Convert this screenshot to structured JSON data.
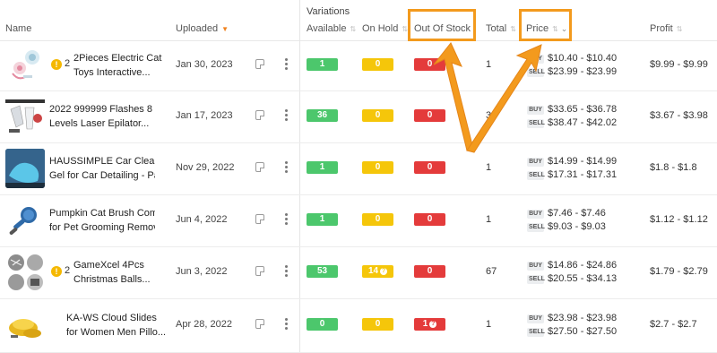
{
  "header": {
    "name": "Name",
    "uploaded": "Uploaded",
    "variations": "Variations",
    "available": "Available",
    "on_hold": "On Hold",
    "out_of_stock": "Out Of Stock",
    "total": "Total",
    "price": "Price",
    "profit": "Profit"
  },
  "rows": [
    {
      "name_l1": "2Pieces Electric Cat",
      "name_l2": "Toys Interactive...",
      "warn_count": "2",
      "uploaded": "Jan 30, 2023",
      "available": "1",
      "on_hold": "0",
      "out_of_stock": "0",
      "total": "1",
      "buy": "$10.40 - $10.40",
      "sell": "$23.99 - $23.99",
      "profit": "$9.99 - $9.99"
    },
    {
      "name_l1": "2022 999999 Flashes 8",
      "name_l2": "Levels Laser Epilator...",
      "warn_count": "",
      "uploaded": "Jan 17, 2023",
      "available": "36",
      "on_hold": "0",
      "out_of_stock": "0",
      "total": "36",
      "buy": "$33.65 - $36.78",
      "sell": "$38.47 - $42.02",
      "profit": "$3.67 - $3.98"
    },
    {
      "name_l1": "HAUSSIMPLE Car Cleaning",
      "name_l2": "Gel for Car Detailing - Pac...",
      "warn_count": "",
      "uploaded": "Nov 29, 2022",
      "available": "1",
      "on_hold": "0",
      "out_of_stock": "0",
      "total": "1",
      "buy": "$14.99 - $14.99",
      "sell": "$17.31 - $17.31",
      "profit": "$1.8 - $1.8"
    },
    {
      "name_l1": "Pumpkin Cat Brush Comb",
      "name_l2": "for Pet Grooming Remove...",
      "warn_count": "",
      "uploaded": "Jun 4, 2022",
      "available": "1",
      "on_hold": "0",
      "out_of_stock": "0",
      "total": "1",
      "buy": "$7.46 - $7.46",
      "sell": "$9.03 - $9.03",
      "profit": "$1.12 - $1.12"
    },
    {
      "name_l1": "GameXcel 4Pcs",
      "name_l2": "Christmas Balls...",
      "warn_count": "2",
      "uploaded": "Jun 3, 2022",
      "available": "53",
      "on_hold": "14",
      "out_of_stock": "0",
      "total": "67",
      "buy": "$14.86 - $24.86",
      "sell": "$20.55 - $34.13",
      "profit": "$1.79 - $2.79"
    },
    {
      "name_l1": "KA-WS Cloud Slides",
      "name_l2": "for Women Men Pillo...",
      "warn_count": "",
      "uploaded": "Apr 28, 2022",
      "available": "0",
      "on_hold": "0",
      "out_of_stock": "1",
      "total": "1",
      "buy": "$23.98 - $23.98",
      "sell": "$27.50 - $27.50",
      "profit": "$2.7 - $2.7"
    }
  ],
  "labels": {
    "buy": "BUY",
    "sell": "SELL",
    "warn_glyph": "!",
    "help_glyph": "?"
  },
  "colors": {
    "available": "#4cc76c",
    "on_hold": "#f5c60a",
    "out_of_stock": "#e43b3b",
    "highlight": "#f39a1d",
    "sort_active": "#f0821e"
  }
}
